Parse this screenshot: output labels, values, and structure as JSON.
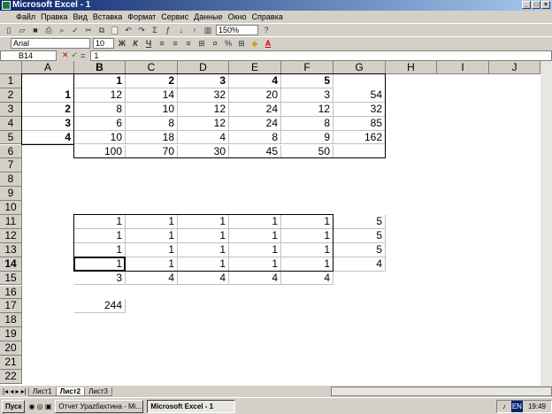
{
  "window": {
    "title": "Microsoft Excel - 1"
  },
  "menu": [
    "Файл",
    "Правка",
    "Вид",
    "Вставка",
    "Формат",
    "Сервис",
    "Данные",
    "Окно",
    "Справка"
  ],
  "toolbar": {
    "zoom": "150%",
    "font": "Arial",
    "size": "10",
    "bold": "Ж",
    "italic": "К",
    "underline": "Ч"
  },
  "formula": {
    "namebox": "B14",
    "value": "1",
    "eq": "="
  },
  "columns": [
    "A",
    "B",
    "C",
    "D",
    "E",
    "F",
    "G",
    "H",
    "I",
    "J"
  ],
  "rows": [
    "1",
    "2",
    "3",
    "4",
    "5",
    "6",
    "7",
    "8",
    "9",
    "10",
    "11",
    "12",
    "13",
    "14",
    "15",
    "16",
    "17",
    "18",
    "19",
    "20",
    "21",
    "22"
  ],
  "cells": [
    {
      "r": 1,
      "c": "B",
      "v": "1",
      "b": true
    },
    {
      "r": 1,
      "c": "C",
      "v": "2",
      "b": true
    },
    {
      "r": 1,
      "c": "D",
      "v": "3",
      "b": true
    },
    {
      "r": 1,
      "c": "E",
      "v": "4",
      "b": true
    },
    {
      "r": 1,
      "c": "F",
      "v": "5",
      "b": true
    },
    {
      "r": 2,
      "c": "A",
      "v": "1",
      "b": true
    },
    {
      "r": 2,
      "c": "B",
      "v": "12"
    },
    {
      "r": 2,
      "c": "C",
      "v": "14"
    },
    {
      "r": 2,
      "c": "D",
      "v": "32"
    },
    {
      "r": 2,
      "c": "E",
      "v": "20"
    },
    {
      "r": 2,
      "c": "F",
      "v": "3"
    },
    {
      "r": 2,
      "c": "G",
      "v": "54"
    },
    {
      "r": 3,
      "c": "A",
      "v": "2",
      "b": true
    },
    {
      "r": 3,
      "c": "B",
      "v": "8"
    },
    {
      "r": 3,
      "c": "C",
      "v": "10"
    },
    {
      "r": 3,
      "c": "D",
      "v": "12"
    },
    {
      "r": 3,
      "c": "E",
      "v": "24"
    },
    {
      "r": 3,
      "c": "F",
      "v": "12"
    },
    {
      "r": 3,
      "c": "G",
      "v": "32"
    },
    {
      "r": 4,
      "c": "A",
      "v": "3",
      "b": true
    },
    {
      "r": 4,
      "c": "B",
      "v": "6"
    },
    {
      "r": 4,
      "c": "C",
      "v": "8"
    },
    {
      "r": 4,
      "c": "D",
      "v": "12"
    },
    {
      "r": 4,
      "c": "E",
      "v": "24"
    },
    {
      "r": 4,
      "c": "F",
      "v": "8"
    },
    {
      "r": 4,
      "c": "G",
      "v": "85"
    },
    {
      "r": 5,
      "c": "A",
      "v": "4",
      "b": true
    },
    {
      "r": 5,
      "c": "B",
      "v": "10"
    },
    {
      "r": 5,
      "c": "C",
      "v": "18"
    },
    {
      "r": 5,
      "c": "D",
      "v": "4"
    },
    {
      "r": 5,
      "c": "E",
      "v": "8"
    },
    {
      "r": 5,
      "c": "F",
      "v": "9"
    },
    {
      "r": 5,
      "c": "G",
      "v": "162"
    },
    {
      "r": 6,
      "c": "B",
      "v": "100"
    },
    {
      "r": 6,
      "c": "C",
      "v": "70"
    },
    {
      "r": 6,
      "c": "D",
      "v": "30"
    },
    {
      "r": 6,
      "c": "E",
      "v": "45"
    },
    {
      "r": 6,
      "c": "F",
      "v": "50"
    },
    {
      "r": 11,
      "c": "B",
      "v": "1"
    },
    {
      "r": 11,
      "c": "C",
      "v": "1"
    },
    {
      "r": 11,
      "c": "D",
      "v": "1"
    },
    {
      "r": 11,
      "c": "E",
      "v": "1"
    },
    {
      "r": 11,
      "c": "F",
      "v": "1"
    },
    {
      "r": 11,
      "c": "G",
      "v": "5"
    },
    {
      "r": 12,
      "c": "B",
      "v": "1"
    },
    {
      "r": 12,
      "c": "C",
      "v": "1"
    },
    {
      "r": 12,
      "c": "D",
      "v": "1"
    },
    {
      "r": 12,
      "c": "E",
      "v": "1"
    },
    {
      "r": 12,
      "c": "F",
      "v": "1"
    },
    {
      "r": 12,
      "c": "G",
      "v": "5"
    },
    {
      "r": 13,
      "c": "B",
      "v": "1"
    },
    {
      "r": 13,
      "c": "C",
      "v": "1"
    },
    {
      "r": 13,
      "c": "D",
      "v": "1"
    },
    {
      "r": 13,
      "c": "E",
      "v": "1"
    },
    {
      "r": 13,
      "c": "F",
      "v": "1"
    },
    {
      "r": 13,
      "c": "G",
      "v": "5"
    },
    {
      "r": 14,
      "c": "B",
      "v": "1"
    },
    {
      "r": 14,
      "c": "C",
      "v": "1"
    },
    {
      "r": 14,
      "c": "D",
      "v": "1"
    },
    {
      "r": 14,
      "c": "E",
      "v": "1"
    },
    {
      "r": 14,
      "c": "F",
      "v": "1"
    },
    {
      "r": 14,
      "c": "G",
      "v": "4"
    },
    {
      "r": 15,
      "c": "B",
      "v": "3"
    },
    {
      "r": 15,
      "c": "C",
      "v": "4"
    },
    {
      "r": 15,
      "c": "D",
      "v": "4"
    },
    {
      "r": 15,
      "c": "E",
      "v": "4"
    },
    {
      "r": 15,
      "c": "F",
      "v": "4"
    },
    {
      "r": 17,
      "c": "B",
      "v": "244"
    }
  ],
  "active": {
    "r": 14,
    "c": "B"
  },
  "sheets": [
    "Лист1",
    "Лист2",
    "Лист3"
  ],
  "active_sheet": 1,
  "taskbar": {
    "start": "Пуск",
    "tasks": [
      "Отчет Урazбахтина - Mi...",
      "Microsoft Excel - 1"
    ],
    "lang": "EN",
    "clock": "19:49"
  }
}
